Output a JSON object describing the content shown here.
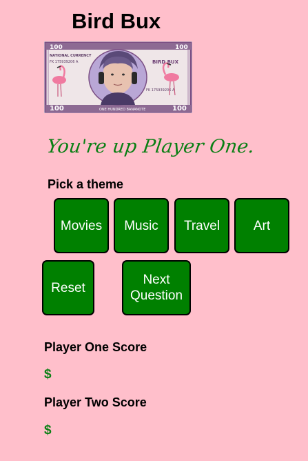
{
  "app": {
    "title": "Bird Bux"
  },
  "banknote": {
    "top_left_corner": "100",
    "top_right_corner": "100",
    "brand": "BIRD BUX",
    "issuer": "NATIONAL CURRENCY",
    "serial_left": "FK 175939206 A",
    "serial_right": "FK 175939206 A",
    "bottom_left_corner": "100",
    "bottom_right_corner": "100",
    "denomination_text": "ONE HUNDRED BANANOTE",
    "colors": {
      "paper": "#efe6e8",
      "frame": "#7a4e84",
      "flamingo": "#f07aa0",
      "portrait_bg": "#b9a7d6"
    }
  },
  "game": {
    "turn_message": "You're up Player One."
  },
  "themes": {
    "label": "Pick a theme",
    "options": [
      "Movies",
      "Music",
      "Travel",
      "Art"
    ]
  },
  "controls": {
    "reset_label": "Reset",
    "next_question_label": "Next Question"
  },
  "scores": {
    "player_one_label": "Player One Score",
    "player_one_value": "$",
    "player_two_label": "Player Two Score",
    "player_two_value": "$"
  },
  "colors": {
    "background": "#ffbfcb",
    "button": "#008000",
    "accent_text": "#0a7f14"
  }
}
